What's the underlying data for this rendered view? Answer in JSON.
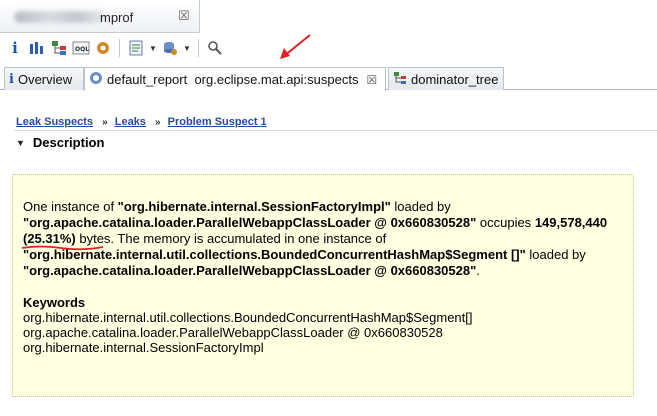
{
  "editor": {
    "tab_title": "mprof",
    "close_glyph": "☒"
  },
  "toolbar": {
    "info_glyph": "i",
    "buttons": [
      "info-icon",
      "histogram-icon",
      "dominator-icon",
      "oql-icon",
      "gear-icon",
      "query-browser-icon",
      "heap-dump-overview-icon",
      "search-icon"
    ]
  },
  "view_tabs": [
    {
      "label": "Overview",
      "icon": "info-icon"
    },
    {
      "label": "default_report  org.eclipse.mat.api:suspects",
      "icon": "report-icon",
      "close": "☒"
    },
    {
      "label": "dominator_tree",
      "icon": "tree-icon"
    }
  ],
  "breadcrumb": {
    "items": [
      "Leak Suspects",
      "Leaks",
      "Problem Suspect 1"
    ],
    "separator": "»"
  },
  "section": {
    "title": "Description"
  },
  "description": {
    "p1": "One instance of ",
    "class1": "\"org.hibernate.internal.SessionFactoryImpl\"",
    "p2": " loaded by ",
    "loader1": "\"org.apache.catalina.loader.ParallelWebappClassLoader @ 0x660830528\"",
    "p3": " occupies ",
    "bytes": "149,578,440",
    "percent": "(25.31%)",
    "p4": " bytes. The memory is accumulated in one instance of ",
    "class2": "\"org.hibernate.internal.util.collections.BoundedConcurrentHashMap$Segment []\"",
    "p5": " loaded by ",
    "loader2": "\"org.apache.catalina.loader.ParallelWebappClassLoader @ 0x660830528\"",
    "p6": "."
  },
  "keywords": {
    "title": "Keywords",
    "items": [
      "org.hibernate.internal.util.collections.BoundedConcurrentHashMap$Segment[]",
      "org.apache.catalina.loader.ParallelWebappClassLoader @ 0x660830528",
      "org.hibernate.internal.SessionFactoryImpl"
    ]
  },
  "colors": {
    "link": "#1d4fa0",
    "box_bg": "#ffffe1",
    "annotation_red": "#e02020"
  }
}
